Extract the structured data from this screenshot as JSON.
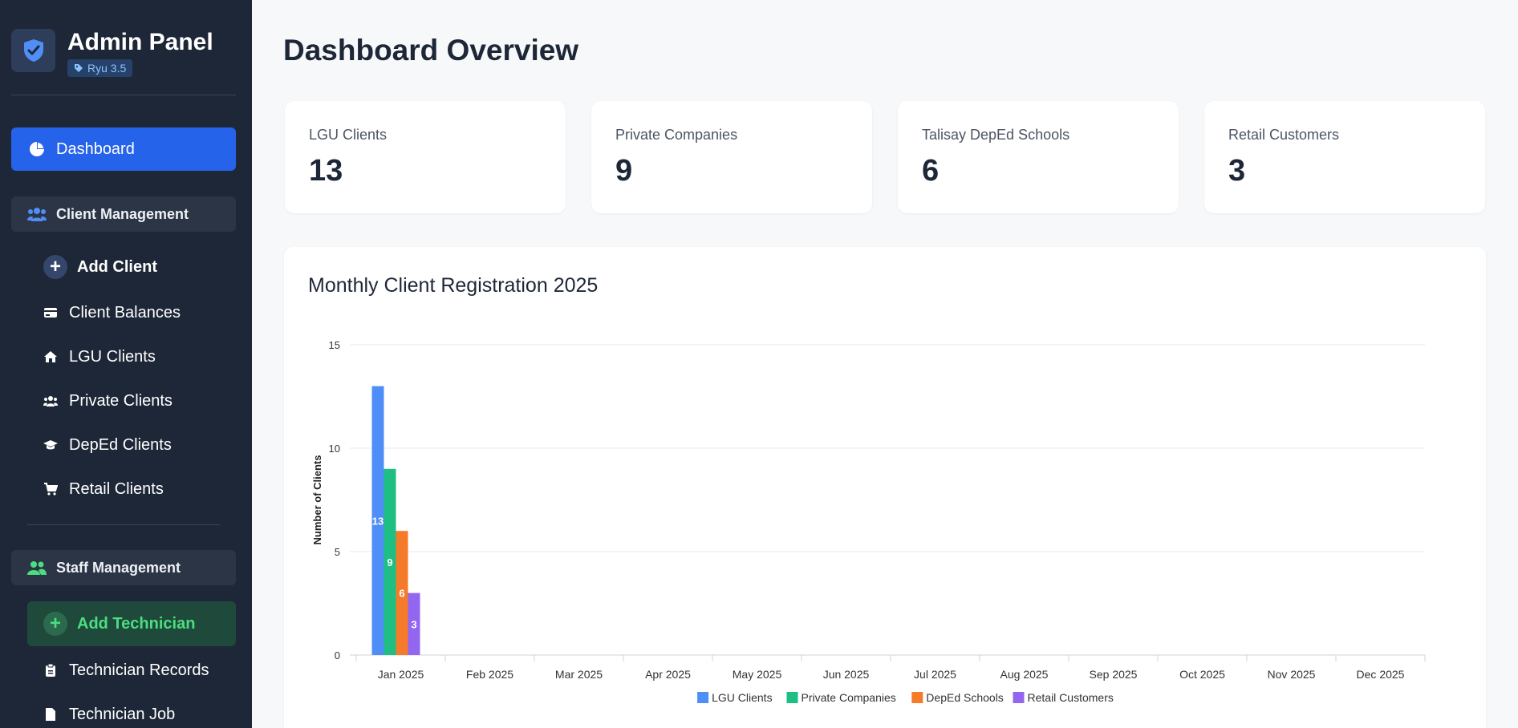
{
  "sidebar": {
    "title": "Admin Panel",
    "version_badge": "Ryu 3.5",
    "dashboard_label": "Dashboard",
    "client_section": "Client Management",
    "add_client": "Add Client",
    "client_items": [
      {
        "label": "Client Balances",
        "icon": "card-icon"
      },
      {
        "label": "LGU Clients",
        "icon": "home-icon"
      },
      {
        "label": "Private Clients",
        "icon": "users-icon"
      },
      {
        "label": "DepEd Clients",
        "icon": "graduation-cap-icon"
      },
      {
        "label": "Retail Clients",
        "icon": "cart-icon"
      }
    ],
    "staff_section": "Staff Management",
    "add_technician": "Add Technician",
    "staff_items": [
      {
        "label": "Technician Records",
        "icon": "clipboard-icon"
      },
      {
        "label": "Technician Job",
        "icon": "file-icon"
      }
    ]
  },
  "main": {
    "title": "Dashboard Overview",
    "stats": [
      {
        "label": "LGU Clients",
        "value": "13"
      },
      {
        "label": "Private Companies",
        "value": "9"
      },
      {
        "label": "Talisay DepEd Schools",
        "value": "6"
      },
      {
        "label": "Retail Customers",
        "value": "3"
      }
    ],
    "chart_title": "Monthly Client Registration 2025"
  },
  "colors": {
    "accent": "#2563eb",
    "sidebar_bg": "#1e2737",
    "lgu": "#4f8ef7",
    "private": "#1fbf84",
    "deped": "#f57b2a",
    "retail": "#9366f2"
  },
  "chart_data": {
    "type": "bar",
    "title": "Monthly Client Registration 2025",
    "ylabel": "Number of Clients",
    "xlabel": "",
    "ylim": [
      0,
      15
    ],
    "yticks": [
      0,
      5,
      10,
      15
    ],
    "categories": [
      "Jan 2025",
      "Feb 2025",
      "Mar 2025",
      "Apr 2025",
      "May 2025",
      "Jun 2025",
      "Jul 2025",
      "Aug 2025",
      "Sep 2025",
      "Oct 2025",
      "Nov 2025",
      "Dec 2025"
    ],
    "series": [
      {
        "name": "LGU Clients",
        "color": "#4f8ef7",
        "values": [
          13,
          0,
          0,
          0,
          0,
          0,
          0,
          0,
          0,
          0,
          0,
          0
        ]
      },
      {
        "name": "Private Companies",
        "color": "#1fbf84",
        "values": [
          9,
          0,
          0,
          0,
          0,
          0,
          0,
          0,
          0,
          0,
          0,
          0
        ]
      },
      {
        "name": "DepEd Schools",
        "color": "#f57b2a",
        "values": [
          6,
          0,
          0,
          0,
          0,
          0,
          0,
          0,
          0,
          0,
          0,
          0
        ]
      },
      {
        "name": "Retail Customers",
        "color": "#9366f2",
        "values": [
          3,
          0,
          0,
          0,
          0,
          0,
          0,
          0,
          0,
          0,
          0,
          0
        ]
      }
    ],
    "grid": true,
    "legend": "bottom-center"
  }
}
